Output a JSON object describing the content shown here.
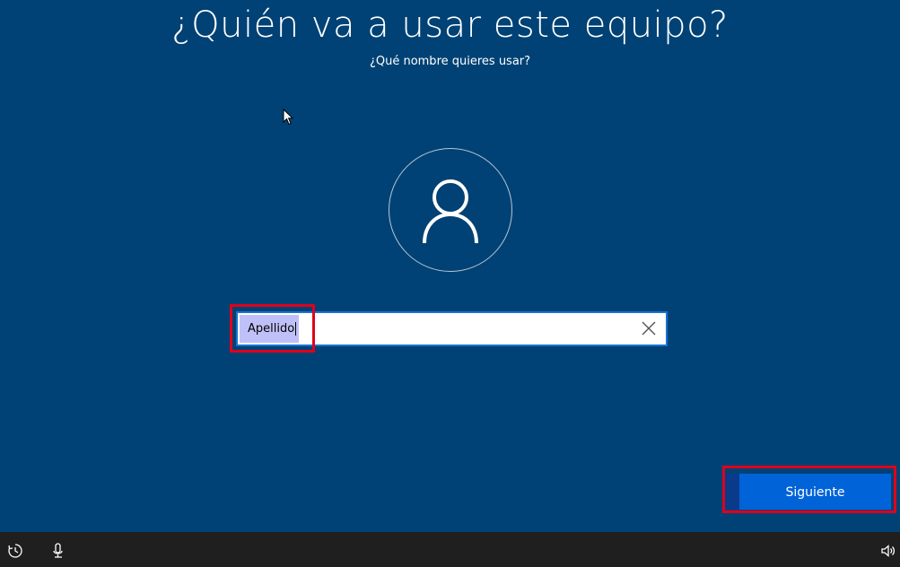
{
  "header": {
    "title": "¿Quién va a usar este equipo?",
    "subtitle": "¿Qué nombre quieres usar?"
  },
  "name_input": {
    "value": "Apellido"
  },
  "buttons": {
    "next_label": "Siguiente"
  },
  "taskbar": {
    "icons": [
      "ease-of-access-icon",
      "microphone-icon",
      "speaker-icon"
    ]
  },
  "colors": {
    "background": "#004275",
    "accent_button": "#0063D8",
    "highlight_box": "#e0001a",
    "taskbar": "#1f1f1f"
  }
}
